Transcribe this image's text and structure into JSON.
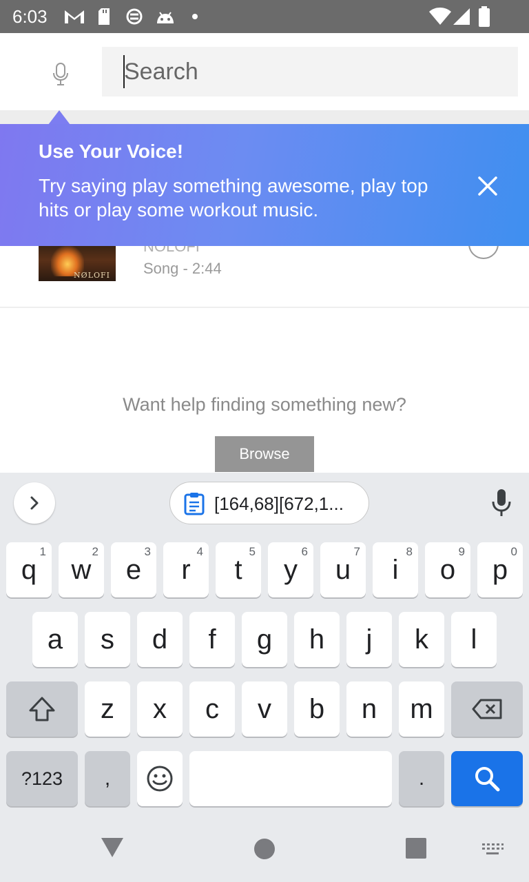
{
  "status_bar": {
    "time": "6:03",
    "icons": [
      "gmail-icon",
      "sd-card-icon",
      "vpn-icon",
      "android-icon",
      "dot-icon",
      "wifi-icon",
      "signal-icon",
      "battery-icon"
    ]
  },
  "search": {
    "placeholder": "Search",
    "mic_icon": "microphone-icon"
  },
  "tooltip": {
    "title": "Use Your Voice!",
    "text": "Try saying play something awesome, play top hits or play some workout music.",
    "close_icon": "close-icon"
  },
  "result": {
    "artist": "NOLOFI",
    "meta": "Song - 2:44",
    "album_label": "NØLOFI"
  },
  "help": {
    "text": "Want help finding something new?",
    "browse_label": "Browse"
  },
  "keyboard": {
    "clipboard_text": "[164,68][672,1...",
    "row1": [
      {
        "k": "q",
        "h": "1"
      },
      {
        "k": "w",
        "h": "2"
      },
      {
        "k": "e",
        "h": "3"
      },
      {
        "k": "r",
        "h": "4"
      },
      {
        "k": "t",
        "h": "5"
      },
      {
        "k": "y",
        "h": "6"
      },
      {
        "k": "u",
        "h": "7"
      },
      {
        "k": "i",
        "h": "8"
      },
      {
        "k": "o",
        "h": "9"
      },
      {
        "k": "p",
        "h": "0"
      }
    ],
    "row2": [
      "a",
      "s",
      "d",
      "f",
      "g",
      "h",
      "j",
      "k",
      "l"
    ],
    "row3": [
      "z",
      "x",
      "c",
      "v",
      "b",
      "n",
      "m"
    ],
    "symbols_label": "?123",
    "comma": ",",
    "period": ".",
    "accent_color": "#1a73e8"
  },
  "colors": {
    "status_bar": "#6b6b6b",
    "tooltip_start": "#7f78f0",
    "tooltip_end": "#3f8ff0",
    "browse_button": "#959595"
  }
}
